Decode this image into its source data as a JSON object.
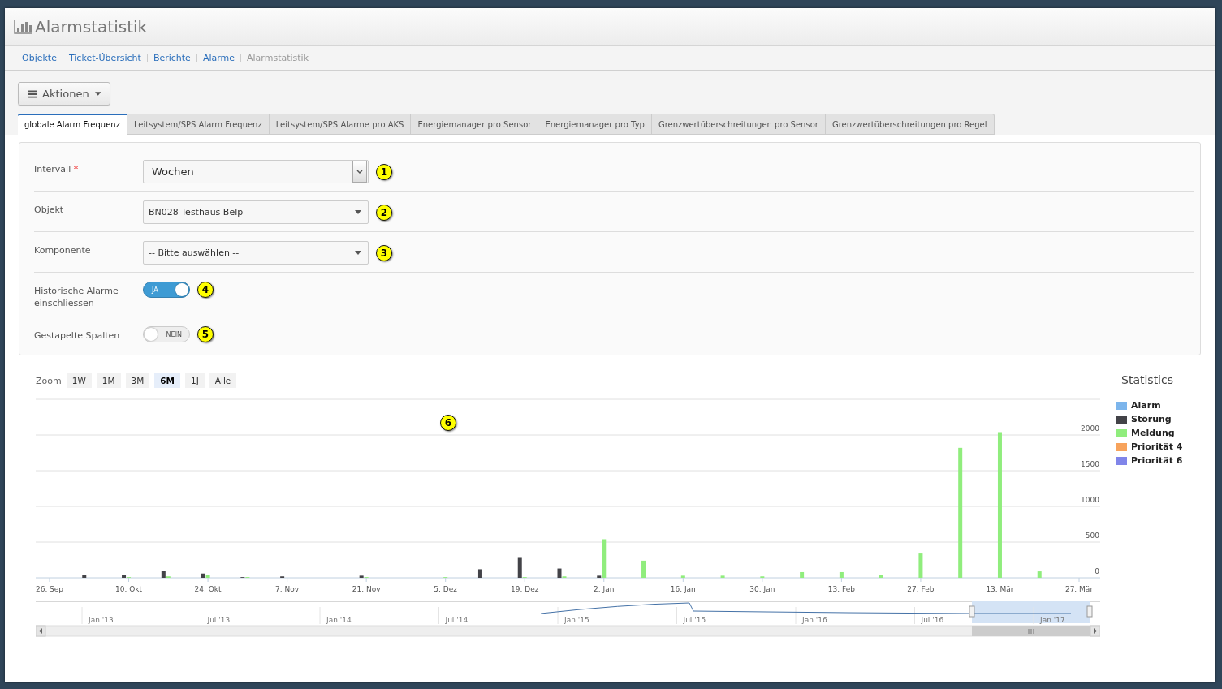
{
  "header": {
    "title": "Alarmstatistik"
  },
  "breadcrumbs": [
    {
      "label": "Objekte",
      "kind": "link"
    },
    {
      "label": "Ticket-Übersicht",
      "kind": "link"
    },
    {
      "label": "Berichte",
      "kind": "link"
    },
    {
      "label": "Alarme",
      "kind": "link"
    },
    {
      "label": "Alarmstatistik",
      "kind": "current"
    }
  ],
  "actions_button": {
    "label": "Aktionen"
  },
  "tabs": [
    {
      "label": "globale Alarm Frequenz",
      "selected": true
    },
    {
      "label": "Leitsystem/SPS Alarm Frequenz",
      "selected": false
    },
    {
      "label": "Leitsystem/SPS Alarme pro AKS",
      "selected": false
    },
    {
      "label": "Energiemanager pro Sensor",
      "selected": false
    },
    {
      "label": "Energiemanager pro Typ",
      "selected": false
    },
    {
      "label": "Grenzwertüberschreitungen pro Sensor",
      "selected": false
    },
    {
      "label": "Grenzwertüberschreitungen pro Regel",
      "selected": false
    }
  ],
  "form": {
    "fields": [
      {
        "kind": "native-select",
        "label": "Intervall",
        "required_mark": "*",
        "value": "Wochen",
        "marker": "1"
      },
      {
        "kind": "dropdown",
        "label": "Objekt",
        "value": "BN028 Testhaus Belp",
        "marker": "2"
      },
      {
        "kind": "dropdown",
        "label": "Komponente",
        "value": "-- Bitte auswählen --",
        "marker": "3"
      },
      {
        "kind": "toggle",
        "label": "Historische Alarme einschliessen",
        "on": true,
        "text": "JA",
        "marker": "4"
      },
      {
        "kind": "toggle",
        "label": "Gestapelte Spalten",
        "on": false,
        "text": "NEIN",
        "marker": "5"
      }
    ]
  },
  "chart": {
    "zoom_label": "Zoom",
    "zoom_buttons": [
      {
        "label": "1W",
        "selected": false
      },
      {
        "label": "1M",
        "selected": false
      },
      {
        "label": "3M",
        "selected": false
      },
      {
        "label": "6M",
        "selected": true
      },
      {
        "label": "1J",
        "selected": false
      },
      {
        "label": "Alle",
        "selected": false
      }
    ],
    "marker": "6",
    "chart_data": {
      "type": "bar",
      "title": "Statistics",
      "categories": [
        "26. Sep",
        null,
        "10. Okt",
        null,
        "24. Okt",
        null,
        "7. Nov",
        null,
        "21. Nov",
        null,
        "5. Dez",
        null,
        "19. Dez",
        null,
        "2. Jan",
        null,
        "16. Jan",
        null,
        "30. Jan",
        null,
        "13. Feb",
        null,
        "27. Feb",
        null,
        "13. Mär",
        null,
        "27. Mär"
      ],
      "series": [
        {
          "name": "Alarm",
          "color": "#7cb5ec",
          "values": [
            0,
            0,
            0,
            0,
            0,
            0,
            0,
            0,
            0,
            0,
            0,
            0,
            0,
            0,
            0,
            0,
            0,
            0,
            0,
            0,
            0,
            0,
            0,
            0,
            0,
            0,
            0
          ]
        },
        {
          "name": "Störung",
          "color": "#434348",
          "values": [
            0,
            40,
            40,
            100,
            60,
            10,
            20,
            0,
            30,
            0,
            0,
            120,
            290,
            130,
            30,
            0,
            0,
            0,
            0,
            0,
            0,
            0,
            0,
            0,
            0,
            0,
            0
          ]
        },
        {
          "name": "Meldung",
          "color": "#90ed7d",
          "values": [
            0,
            0,
            10,
            20,
            40,
            10,
            0,
            0,
            10,
            0,
            10,
            0,
            10,
            20,
            540,
            240,
            30,
            30,
            20,
            80,
            80,
            40,
            340,
            1820,
            2040,
            90,
            0
          ]
        },
        {
          "name": "Priorität 4",
          "color": "#f7a35c",
          "values": [
            0,
            0,
            0,
            0,
            0,
            0,
            0,
            0,
            0,
            0,
            0,
            0,
            0,
            0,
            0,
            0,
            0,
            0,
            0,
            0,
            0,
            0,
            0,
            0,
            0,
            0,
            0
          ]
        },
        {
          "name": "Priorität 6",
          "color": "#8085e9",
          "values": [
            0,
            0,
            0,
            0,
            0,
            0,
            0,
            0,
            0,
            0,
            0,
            0,
            0,
            0,
            0,
            0,
            0,
            0,
            0,
            0,
            0,
            0,
            0,
            0,
            0,
            0,
            0
          ]
        }
      ],
      "ylim": [
        0,
        2500
      ],
      "yticks": [
        0,
        500,
        1000,
        1500,
        2000
      ],
      "grid": true
    },
    "navigator_labels": [
      "Jan '13",
      "Jul '13",
      "Jan '14",
      "Jul '14",
      "Jan '15",
      "Jul '15",
      "Jan '16",
      "Jul '16",
      "Jan '17"
    ]
  }
}
